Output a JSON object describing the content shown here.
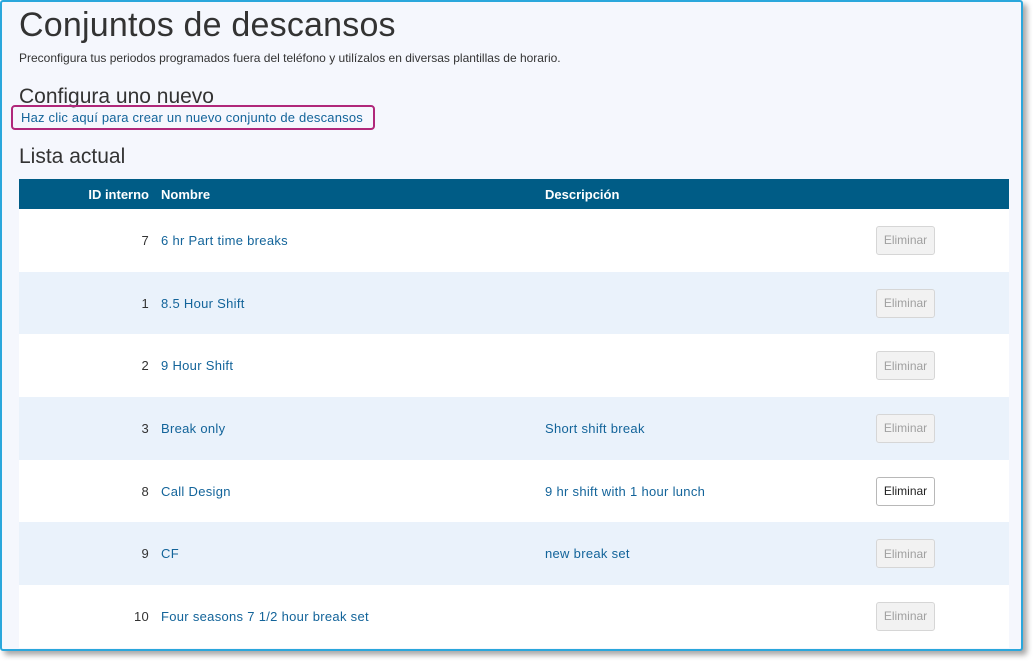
{
  "page": {
    "title": "Conjuntos de descansos",
    "subtitle": "Preconfigura tus periodos programados fuera del teléfono y utilízalos en diversas plantillas de horario."
  },
  "new_section": {
    "heading": "Configura uno nuevo",
    "create_link": "Haz clic aquí para crear un nuevo conjunto de descansos"
  },
  "list_section": {
    "heading": "Lista actual",
    "columns": {
      "id": "ID interno",
      "name": "Nombre",
      "description": "Descripción",
      "actions": ""
    },
    "rows": [
      {
        "id": "7",
        "name": "6 hr Part time breaks",
        "description": "",
        "delete_label": "Eliminar",
        "delete_enabled": false
      },
      {
        "id": "1",
        "name": "8.5 Hour Shift",
        "description": "",
        "delete_label": "Eliminar",
        "delete_enabled": false
      },
      {
        "id": "2",
        "name": "9 Hour Shift",
        "description": "",
        "delete_label": "Eliminar",
        "delete_enabled": false
      },
      {
        "id": "3",
        "name": "Break only",
        "description": "Short shift break",
        "delete_label": "Eliminar",
        "delete_enabled": false
      },
      {
        "id": "8",
        "name": "Call Design",
        "description": "9 hr shift with 1 hour lunch",
        "delete_label": "Eliminar",
        "delete_enabled": true
      },
      {
        "id": "9",
        "name": "CF",
        "description": "new break set",
        "delete_label": "Eliminar",
        "delete_enabled": false
      },
      {
        "id": "10",
        "name": "Four seasons 7 1/2 hour break set",
        "description": "",
        "delete_label": "Eliminar",
        "delete_enabled": false
      }
    ]
  },
  "colors": {
    "header_bg": "#005c86",
    "link": "#13649a",
    "highlight_border": "#b0277a",
    "frame_border": "#2aa7dc",
    "row_alt": "#eaf2fb"
  }
}
